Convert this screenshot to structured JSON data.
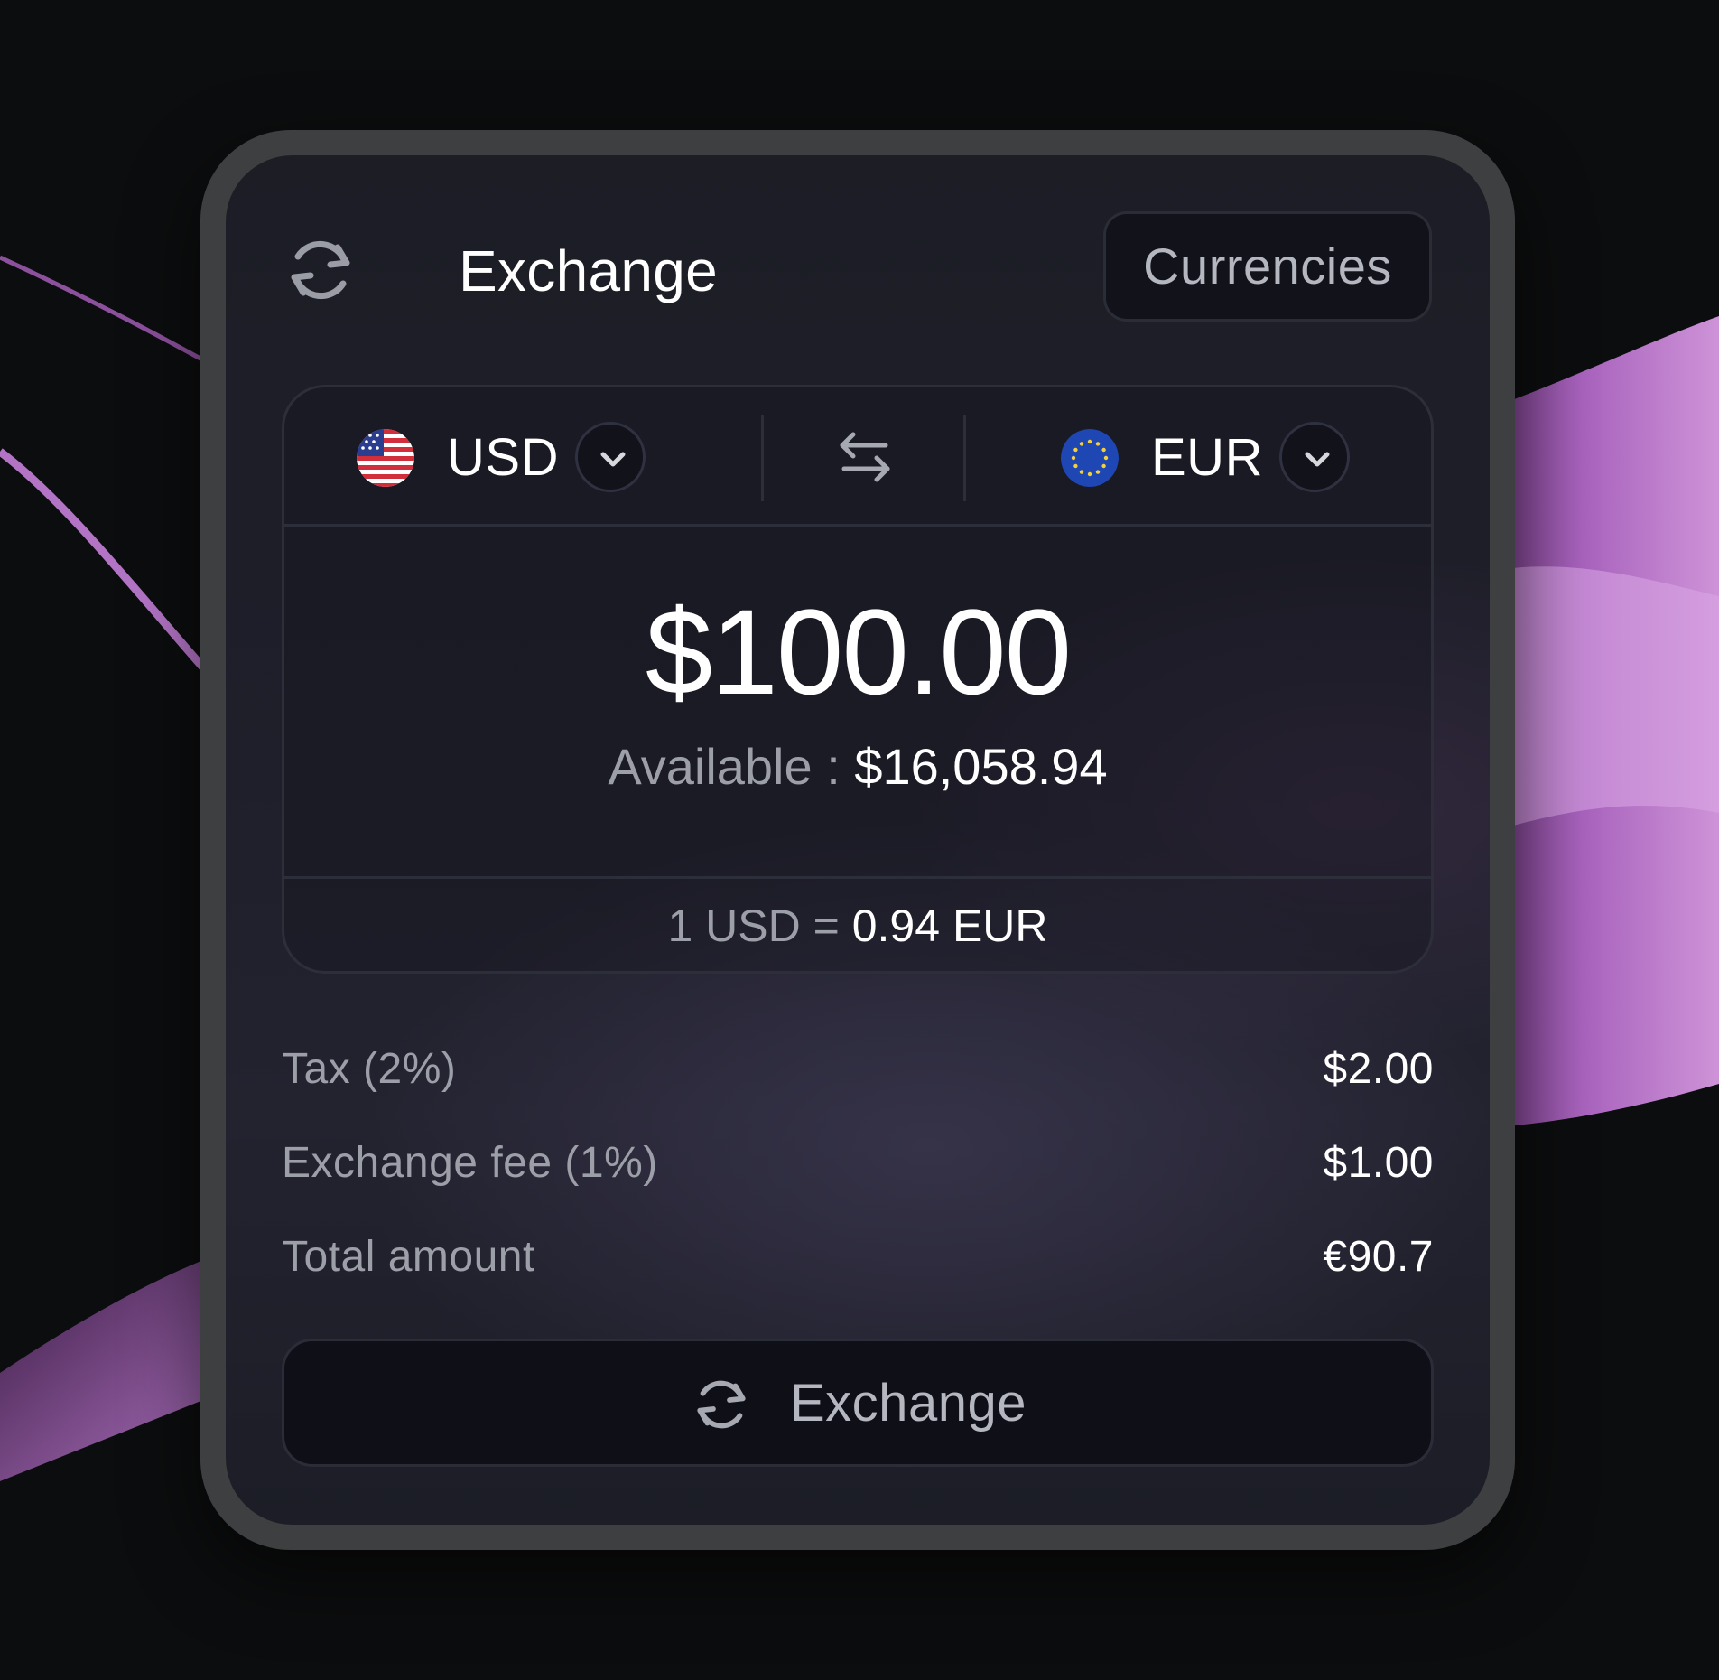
{
  "colors": {
    "background": "#0c0d0e",
    "accent_ribbon": "#b26bc4",
    "card_background": "#1e1f2a",
    "text_primary": "#ffffff",
    "text_secondary": "#9c9ea8"
  },
  "header": {
    "icon": "refresh-icon",
    "title": "Exchange",
    "currencies_button": "Currencies"
  },
  "converter": {
    "from": {
      "code": "USD",
      "flag": "us-flag-icon",
      "chevron": "chevron-down-icon"
    },
    "swap_icon": "swap-arrows-icon",
    "to": {
      "code": "EUR",
      "flag": "eu-flag-icon",
      "chevron": "chevron-down-icon"
    },
    "amount": "$100.00",
    "available_label": "Available :",
    "available_value": "$16,058.94",
    "rate_label": "1 USD =",
    "rate_value": "0.94 EUR"
  },
  "summary": [
    {
      "label": "Tax (2%)",
      "value": "$2.00"
    },
    {
      "label": "Exchange fee (1%)",
      "value": "$1.00"
    },
    {
      "label": "Total amount",
      "value": "€90.7"
    }
  ],
  "action": {
    "icon": "refresh-icon",
    "label": "Exchange"
  }
}
